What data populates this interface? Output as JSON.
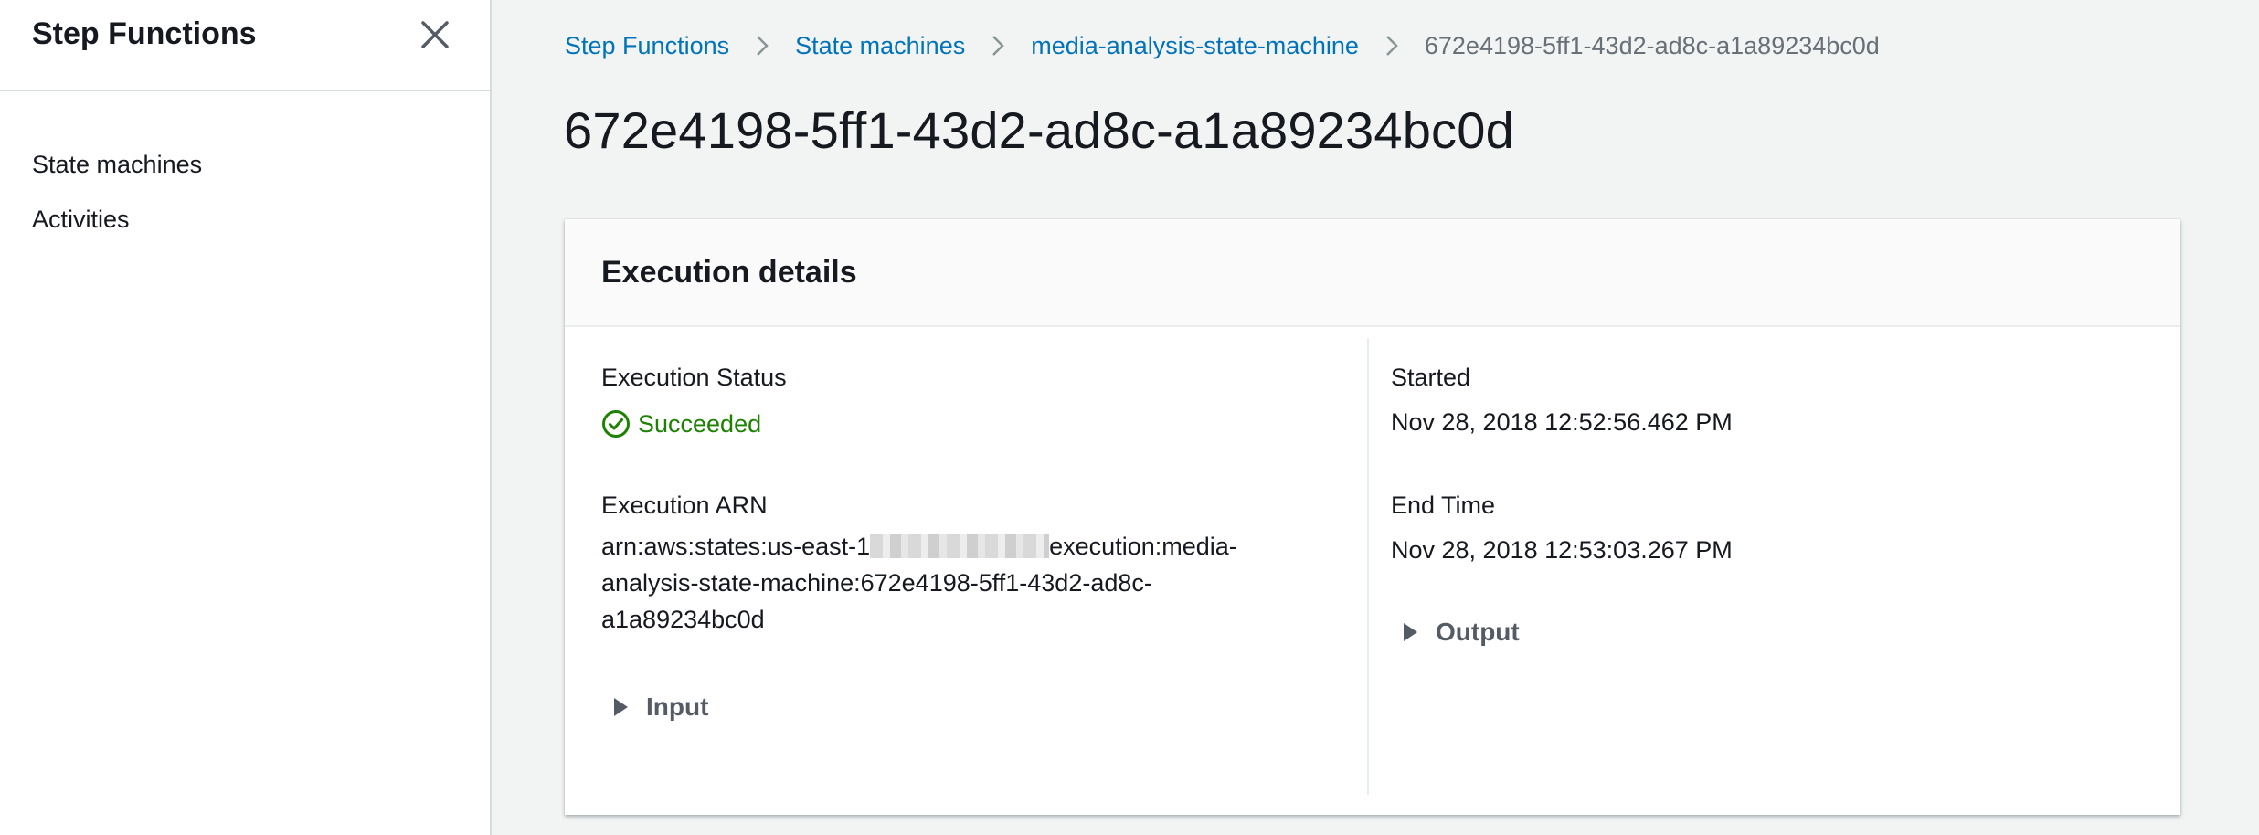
{
  "sidebar": {
    "title": "Step Functions",
    "close_icon": "close-icon",
    "items": [
      {
        "label": "State machines"
      },
      {
        "label": "Activities"
      }
    ]
  },
  "breadcrumb": {
    "items": [
      {
        "label": "Step Functions"
      },
      {
        "label": "State machines"
      },
      {
        "label": "media-analysis-state-machine"
      }
    ],
    "current": "672e4198-5ff1-43d2-ad8c-a1a89234bc0d",
    "separator_icon": "chevron-right-icon"
  },
  "page": {
    "title": "672e4198-5ff1-43d2-ad8c-a1a89234bc0d"
  },
  "execution_details": {
    "heading": "Execution details",
    "status_label": "Execution Status",
    "status_value": "Succeeded",
    "status_icon": "check-circle-icon",
    "arn_label": "Execution ARN",
    "arn_line1_prefix": "arn:aws:states:us-east-1",
    "arn_line1_suffix": "execution:media-",
    "arn_line2": "analysis-state-machine:672e4198-5ff1-43d2-ad8c-",
    "arn_line3": "a1a89234bc0d",
    "input_label": "Input",
    "started_label": "Started",
    "started_value": "Nov 28, 2018 12:52:56.462 PM",
    "end_label": "End Time",
    "end_value": "Nov 28, 2018 12:53:03.267 PM",
    "output_label": "Output"
  },
  "colors": {
    "link": "#0073bb",
    "success": "#1d8102",
    "background": "#f2f3f3"
  }
}
